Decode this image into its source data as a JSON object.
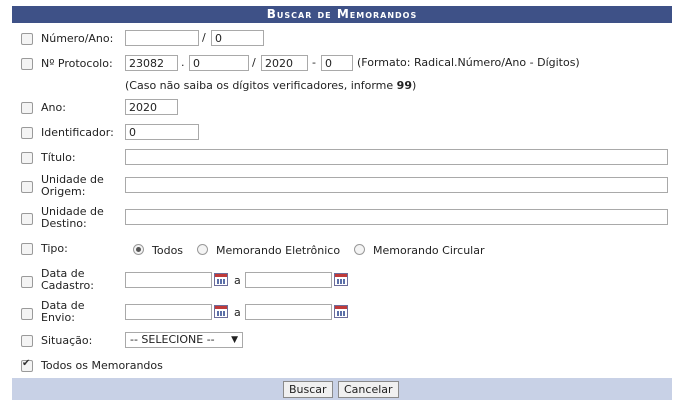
{
  "title": "Buscar de Memorandos",
  "numero_ano": {
    "label": "Número/Ano:",
    "numero": "",
    "sep": "/",
    "ano": "0"
  },
  "protocolo": {
    "label": "Nº Protocolo:",
    "radical": "23082",
    "sep1": ".",
    "numero": "0",
    "sep2": "/",
    "ano": "2020",
    "sep3": "-",
    "digitos": "0",
    "formato": "(Formato: Radical.Número/Ano - Dígitos)",
    "hint_prefix": "(Caso não saiba os dígitos verificadores, informe ",
    "hint_bold": "99",
    "hint_suffix": ")"
  },
  "ano": {
    "label": "Ano:",
    "value": "2020"
  },
  "identificador": {
    "label": "Identificador:",
    "value": "0"
  },
  "titulo": {
    "label": "Título:",
    "value": ""
  },
  "unidade_origem": {
    "label_line1": "Unidade de",
    "label_line2": "Origem:",
    "value": ""
  },
  "unidade_destino": {
    "label_line1": "Unidade de",
    "label_line2": "Destino:",
    "value": ""
  },
  "tipo": {
    "label": "Tipo:",
    "options": [
      "Todos",
      "Memorando Eletrônico",
      "Memorando Circular"
    ],
    "selected": "Todos"
  },
  "data_cadastro": {
    "label_line1": "Data de",
    "label_line2": "Cadastro:",
    "inicio": "",
    "sep": "a",
    "fim": ""
  },
  "data_envio": {
    "label_line1": "Data de",
    "label_line2": "Envio:",
    "inicio": "",
    "sep": "a",
    "fim": ""
  },
  "situacao": {
    "label": "Situação:",
    "selected": "-- SELECIONE --"
  },
  "todos": {
    "label": "Todos os Memorandos",
    "checked": true
  },
  "buttons": {
    "buscar": "Buscar",
    "cancelar": "Cancelar"
  },
  "colors": {
    "header": "#3e5187",
    "footer": "#c8d1e6"
  },
  "icons": {
    "calendar": "calendar-icon",
    "dropdown": "chevron-down-icon"
  }
}
